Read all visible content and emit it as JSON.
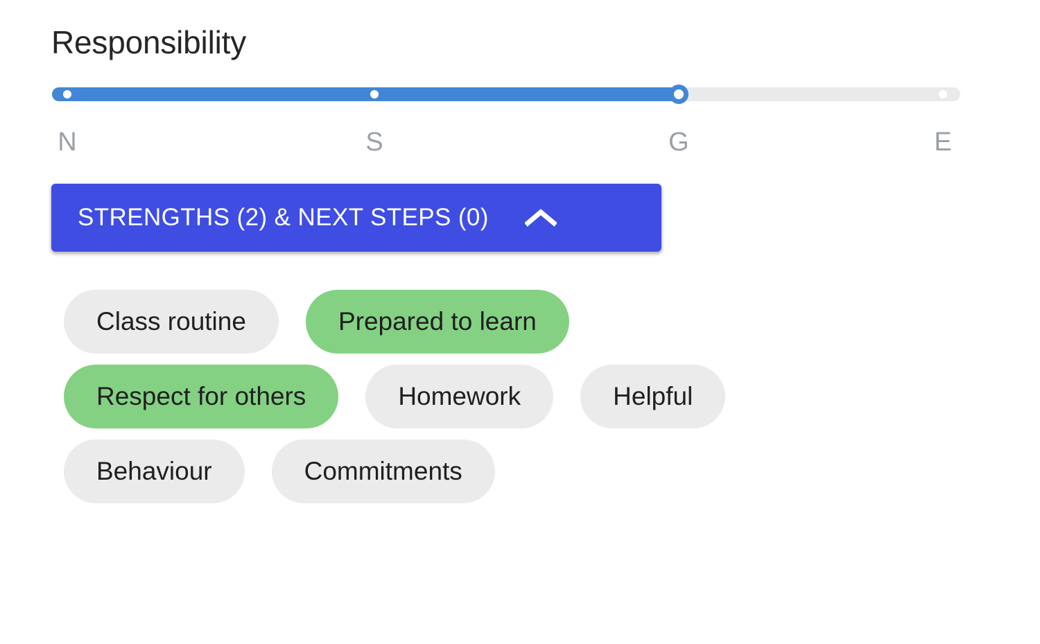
{
  "section": {
    "title": "Responsibility"
  },
  "slider": {
    "name": "responsibility-level-slider",
    "ticks": [
      {
        "label": "N",
        "position_pct": 0
      },
      {
        "label": "S",
        "position_pct": 35.5
      },
      {
        "label": "G",
        "position_pct": 69
      },
      {
        "label": "E",
        "position_pct": 100
      }
    ],
    "value_label": "G",
    "value_index": 2,
    "fill_pct": 69,
    "active_color": "#4287d6",
    "inactive_color": "#e9eaec",
    "thumb_color": "#ffffff",
    "tick_label_color": "#9aa0a6"
  },
  "expand_button": {
    "label": "STRENGTHS (2) & NEXT STEPS (0)",
    "strengths_count": 2,
    "next_steps_count": 0,
    "expanded": true,
    "icon": "chevron-up-icon",
    "background_color": "#3f4de3",
    "text_color": "#ffffff"
  },
  "chips": {
    "selected_color": "#84d184",
    "unselected_color": "#ebebeb",
    "rows": [
      [
        {
          "label": "Class routine",
          "selected": false
        },
        {
          "label": "Prepared to learn",
          "selected": true
        }
      ],
      [
        {
          "label": "Respect for others",
          "selected": true
        },
        {
          "label": "Homework",
          "selected": false
        },
        {
          "label": "Helpful",
          "selected": false
        }
      ],
      [
        {
          "label": "Behaviour",
          "selected": false
        },
        {
          "label": "Commitments",
          "selected": false
        }
      ]
    ]
  }
}
